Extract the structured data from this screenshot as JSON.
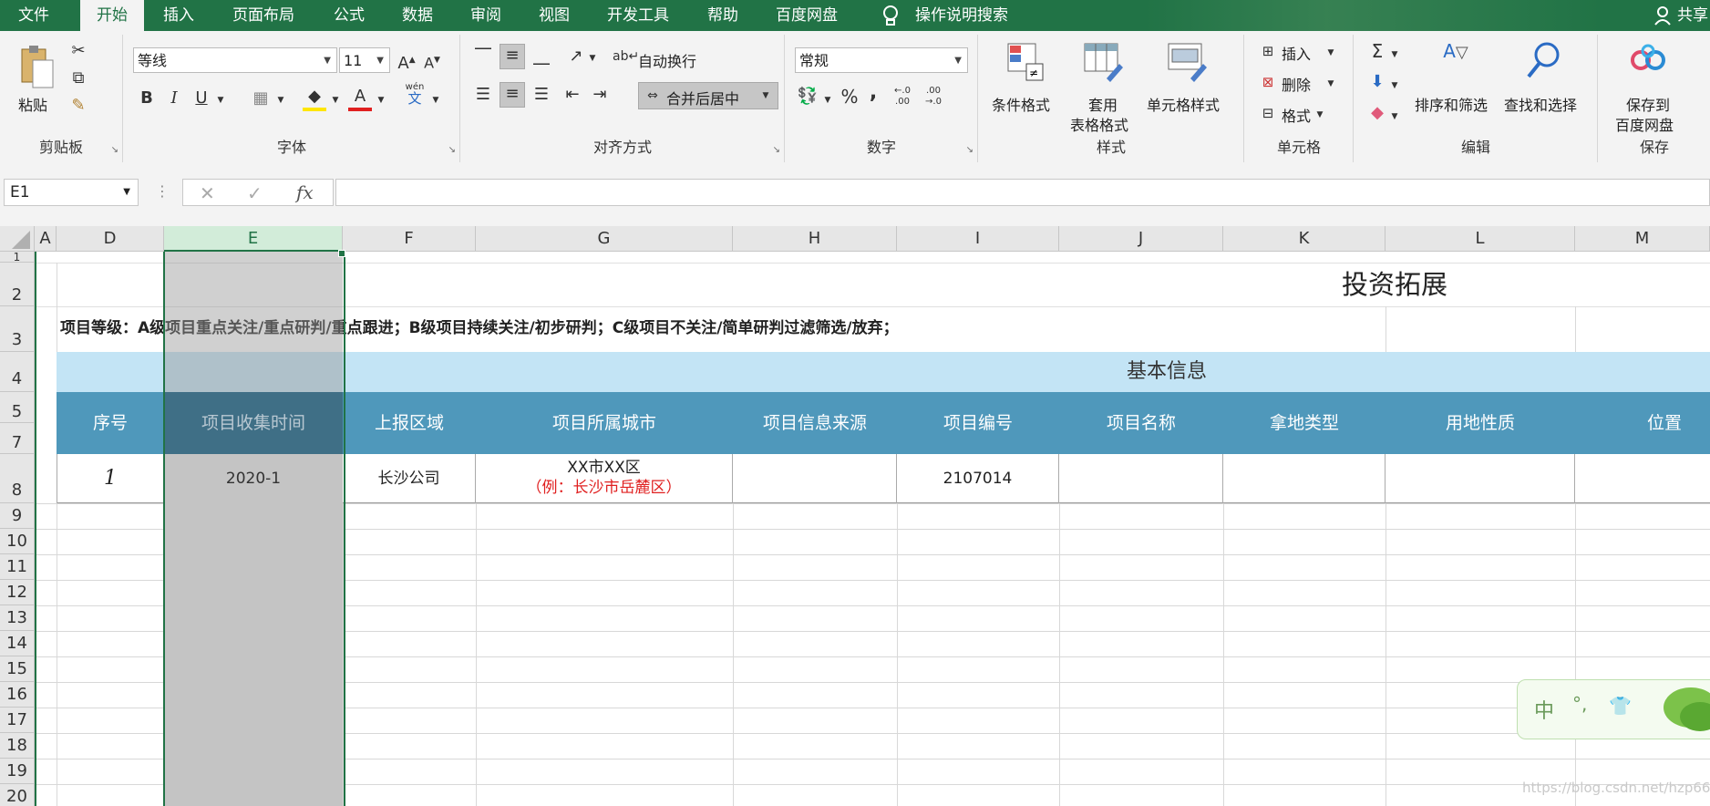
{
  "menu": {
    "tabs": [
      "文件",
      "开始",
      "插入",
      "页面布局",
      "公式",
      "数据",
      "审阅",
      "视图",
      "开发工具",
      "帮助",
      "百度网盘"
    ],
    "active_tab": "开始",
    "tell_me": "操作说明搜索",
    "share": "共享"
  },
  "ribbon": {
    "clipboard": {
      "label": "剪贴板",
      "paste": "粘贴"
    },
    "font": {
      "label": "字体",
      "font_name": "等线",
      "font_size": "11",
      "bold": "B",
      "italic": "I",
      "underline": "U",
      "wen": "wén",
      "wen2": "文"
    },
    "alignment": {
      "label": "对齐方式",
      "wrap_text": "自动换行",
      "merge_center": "合并后居中"
    },
    "number": {
      "label": "数字",
      "format": "常规",
      "percent": "%",
      "comma": ","
    },
    "styles": {
      "label": "样式",
      "conditional": "条件格式",
      "table_format_1": "套用",
      "table_format_2": "表格格式",
      "cell_styles": "单元格样式"
    },
    "cells": {
      "label": "单元格",
      "insert": "插入",
      "delete": "删除",
      "format": "格式"
    },
    "editing": {
      "label": "编辑",
      "sort_filter": "排序和筛选",
      "find_select": "查找和选择"
    },
    "save": {
      "label": "保存",
      "save_to_1": "保存到",
      "save_to_2": "百度网盘"
    }
  },
  "formula_bar": {
    "name_box": "E1",
    "cancel": "✕",
    "enter": "✓",
    "fx": "fx",
    "formula": ""
  },
  "columns": [
    "A",
    "D",
    "E",
    "F",
    "G",
    "H",
    "I",
    "J",
    "K",
    "L",
    "M"
  ],
  "rows": [
    "1",
    "2",
    "3",
    "4",
    "5",
    "7",
    "8",
    "9",
    "10",
    "11",
    "12",
    "13",
    "14",
    "15",
    "16",
    "17",
    "18",
    "19",
    "20"
  ],
  "sheet": {
    "title": "投资拓展",
    "note": "项目等级：A级项目重点关注/重点研判/重点跟进；B级项目持续关注/初步研判；C级项目不关注/简单研判过滤筛选/放弃；",
    "section": "基本信息",
    "headers": [
      "序号",
      "项目收集时间",
      "上报区域",
      "项目所属城市",
      "项目信息来源",
      "项目编号",
      "项目名称",
      "拿地类型",
      "用地性质",
      "位置"
    ],
    "row8": {
      "seq": "1",
      "time": "2020-1",
      "region": "长沙公司",
      "city": "XX市XX区",
      "city_example": "（例：长沙市岳麓区）",
      "source": "",
      "code": "2107014"
    }
  },
  "ime": {
    "zh": "中",
    "punct": "°,"
  },
  "watermark": "https://blog.csdn.net/hzp666",
  "colors": {
    "excel_green": "#217346",
    "header_blue": "#4f98bb",
    "light_blue": "#c3e4f5",
    "selected_gray": "#c4c4c4",
    "red_text": "#e02020"
  }
}
